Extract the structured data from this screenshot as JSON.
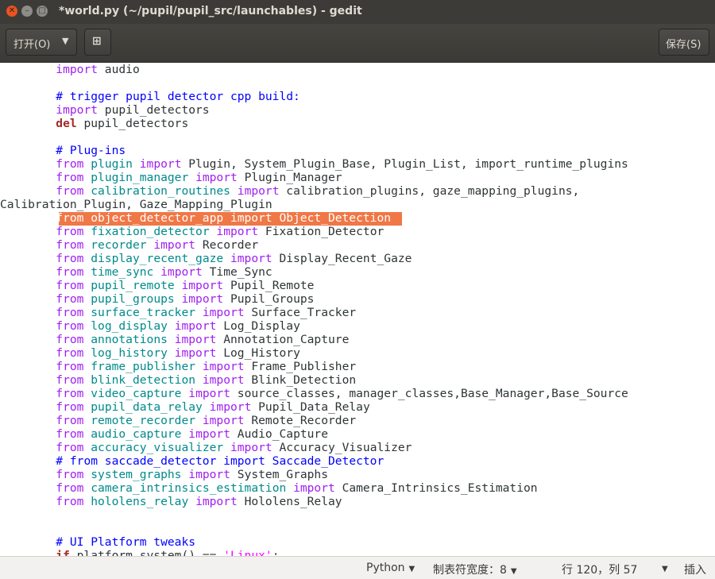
{
  "window": {
    "title": "*world.py (~/pupil/pupil_src/launchables) - gedit"
  },
  "toolbar": {
    "open_label": "打开(O)",
    "save_label": "保存(S)"
  },
  "editor": {
    "lines": [
      {
        "segs": [
          {
            "t": "        "
          },
          {
            "c": "kw",
            "t": "import"
          },
          {
            "t": " audio"
          }
        ]
      },
      {
        "segs": []
      },
      {
        "segs": [
          {
            "t": "        "
          },
          {
            "c": "cm",
            "t": "# trigger pupil detector cpp build:"
          }
        ]
      },
      {
        "segs": [
          {
            "t": "        "
          },
          {
            "c": "kw",
            "t": "import"
          },
          {
            "t": " pupil_detectors"
          }
        ]
      },
      {
        "segs": [
          {
            "t": "        "
          },
          {
            "c": "del",
            "t": "del"
          },
          {
            "t": " pupil_detectors"
          }
        ]
      },
      {
        "segs": []
      },
      {
        "segs": [
          {
            "t": "        "
          },
          {
            "c": "cm",
            "t": "# Plug-ins"
          }
        ]
      },
      {
        "segs": [
          {
            "t": "        "
          },
          {
            "c": "kw",
            "t": "from"
          },
          {
            "t": " "
          },
          {
            "c": "mod",
            "t": "plugin"
          },
          {
            "t": " "
          },
          {
            "c": "kw",
            "t": "import"
          },
          {
            "t": " Plugin, System_Plugin_Base, Plugin_List, import_runtime_plugins"
          }
        ]
      },
      {
        "segs": [
          {
            "t": "        "
          },
          {
            "c": "kw",
            "t": "from"
          },
          {
            "t": " "
          },
          {
            "c": "mod",
            "t": "plugin_manager"
          },
          {
            "t": " "
          },
          {
            "c": "kw",
            "t": "import"
          },
          {
            "t": " Plugin_Manager"
          }
        ]
      },
      {
        "segs": [
          {
            "t": "        "
          },
          {
            "c": "kw",
            "t": "from"
          },
          {
            "t": " "
          },
          {
            "c": "mod",
            "t": "calibration_routines"
          },
          {
            "t": " "
          },
          {
            "c": "kw",
            "t": "import"
          },
          {
            "t": " calibration_plugins, gaze_mapping_plugins,"
          }
        ]
      },
      {
        "segs": [
          {
            "t": "Calibration_Plugin, Gaze_Mapping_Plugin"
          }
        ]
      },
      {
        "hl": true,
        "segs": [
          {
            "t": "        from object_detector_app import Object_Detection"
          }
        ]
      },
      {
        "segs": [
          {
            "t": "        "
          },
          {
            "c": "kw",
            "t": "from"
          },
          {
            "t": " "
          },
          {
            "c": "mod",
            "t": "fixation_detector"
          },
          {
            "t": " "
          },
          {
            "c": "kw",
            "t": "import"
          },
          {
            "t": " Fixation_Detector"
          }
        ]
      },
      {
        "segs": [
          {
            "t": "        "
          },
          {
            "c": "kw",
            "t": "from"
          },
          {
            "t": " "
          },
          {
            "c": "mod",
            "t": "recorder"
          },
          {
            "t": " "
          },
          {
            "c": "kw",
            "t": "import"
          },
          {
            "t": " Recorder"
          }
        ]
      },
      {
        "segs": [
          {
            "t": "        "
          },
          {
            "c": "kw",
            "t": "from"
          },
          {
            "t": " "
          },
          {
            "c": "mod",
            "t": "display_recent_gaze"
          },
          {
            "t": " "
          },
          {
            "c": "kw",
            "t": "import"
          },
          {
            "t": " Display_Recent_Gaze"
          }
        ]
      },
      {
        "segs": [
          {
            "t": "        "
          },
          {
            "c": "kw",
            "t": "from"
          },
          {
            "t": " "
          },
          {
            "c": "mod",
            "t": "time_sync"
          },
          {
            "t": " "
          },
          {
            "c": "kw",
            "t": "import"
          },
          {
            "t": " Time_Sync"
          }
        ]
      },
      {
        "segs": [
          {
            "t": "        "
          },
          {
            "c": "kw",
            "t": "from"
          },
          {
            "t": " "
          },
          {
            "c": "mod",
            "t": "pupil_remote"
          },
          {
            "t": " "
          },
          {
            "c": "kw",
            "t": "import"
          },
          {
            "t": " Pupil_Remote"
          }
        ]
      },
      {
        "segs": [
          {
            "t": "        "
          },
          {
            "c": "kw",
            "t": "from"
          },
          {
            "t": " "
          },
          {
            "c": "mod",
            "t": "pupil_groups"
          },
          {
            "t": " "
          },
          {
            "c": "kw",
            "t": "import"
          },
          {
            "t": " Pupil_Groups"
          }
        ]
      },
      {
        "segs": [
          {
            "t": "        "
          },
          {
            "c": "kw",
            "t": "from"
          },
          {
            "t": " "
          },
          {
            "c": "mod",
            "t": "surface_tracker"
          },
          {
            "t": " "
          },
          {
            "c": "kw",
            "t": "import"
          },
          {
            "t": " Surface_Tracker"
          }
        ]
      },
      {
        "segs": [
          {
            "t": "        "
          },
          {
            "c": "kw",
            "t": "from"
          },
          {
            "t": " "
          },
          {
            "c": "mod",
            "t": "log_display"
          },
          {
            "t": " "
          },
          {
            "c": "kw",
            "t": "import"
          },
          {
            "t": " Log_Display"
          }
        ]
      },
      {
        "segs": [
          {
            "t": "        "
          },
          {
            "c": "kw",
            "t": "from"
          },
          {
            "t": " "
          },
          {
            "c": "mod",
            "t": "annotations"
          },
          {
            "t": " "
          },
          {
            "c": "kw",
            "t": "import"
          },
          {
            "t": " Annotation_Capture"
          }
        ]
      },
      {
        "segs": [
          {
            "t": "        "
          },
          {
            "c": "kw",
            "t": "from"
          },
          {
            "t": " "
          },
          {
            "c": "mod",
            "t": "log_history"
          },
          {
            "t": " "
          },
          {
            "c": "kw",
            "t": "import"
          },
          {
            "t": " Log_History"
          }
        ]
      },
      {
        "segs": [
          {
            "t": "        "
          },
          {
            "c": "kw",
            "t": "from"
          },
          {
            "t": " "
          },
          {
            "c": "mod",
            "t": "frame_publisher"
          },
          {
            "t": " "
          },
          {
            "c": "kw",
            "t": "import"
          },
          {
            "t": " Frame_Publisher"
          }
        ]
      },
      {
        "segs": [
          {
            "t": "        "
          },
          {
            "c": "kw",
            "t": "from"
          },
          {
            "t": " "
          },
          {
            "c": "mod",
            "t": "blink_detection"
          },
          {
            "t": " "
          },
          {
            "c": "kw",
            "t": "import"
          },
          {
            "t": " Blink_Detection"
          }
        ]
      },
      {
        "segs": [
          {
            "t": "        "
          },
          {
            "c": "kw",
            "t": "from"
          },
          {
            "t": " "
          },
          {
            "c": "mod",
            "t": "video_capture"
          },
          {
            "t": " "
          },
          {
            "c": "kw",
            "t": "import"
          },
          {
            "t": " source_classes, manager_classes,Base_Manager,Base_Source"
          }
        ]
      },
      {
        "segs": [
          {
            "t": "        "
          },
          {
            "c": "kw",
            "t": "from"
          },
          {
            "t": " "
          },
          {
            "c": "mod",
            "t": "pupil_data_relay"
          },
          {
            "t": " "
          },
          {
            "c": "kw",
            "t": "import"
          },
          {
            "t": " Pupil_Data_Relay"
          }
        ]
      },
      {
        "segs": [
          {
            "t": "        "
          },
          {
            "c": "kw",
            "t": "from"
          },
          {
            "t": " "
          },
          {
            "c": "mod",
            "t": "remote_recorder"
          },
          {
            "t": " "
          },
          {
            "c": "kw",
            "t": "import"
          },
          {
            "t": " Remote_Recorder"
          }
        ]
      },
      {
        "segs": [
          {
            "t": "        "
          },
          {
            "c": "kw",
            "t": "from"
          },
          {
            "t": " "
          },
          {
            "c": "mod",
            "t": "audio_capture"
          },
          {
            "t": " "
          },
          {
            "c": "kw",
            "t": "import"
          },
          {
            "t": " Audio_Capture"
          }
        ]
      },
      {
        "segs": [
          {
            "t": "        "
          },
          {
            "c": "kw",
            "t": "from"
          },
          {
            "t": " "
          },
          {
            "c": "mod",
            "t": "accuracy_visualizer"
          },
          {
            "t": " "
          },
          {
            "c": "kw",
            "t": "import"
          },
          {
            "t": " Accuracy_Visualizer"
          }
        ]
      },
      {
        "segs": [
          {
            "t": "        "
          },
          {
            "c": "cm",
            "t": "# from saccade_detector import Saccade_Detector"
          }
        ]
      },
      {
        "segs": [
          {
            "t": "        "
          },
          {
            "c": "kw",
            "t": "from"
          },
          {
            "t": " "
          },
          {
            "c": "mod",
            "t": "system_graphs"
          },
          {
            "t": " "
          },
          {
            "c": "kw",
            "t": "import"
          },
          {
            "t": " System_Graphs"
          }
        ]
      },
      {
        "segs": [
          {
            "t": "        "
          },
          {
            "c": "kw",
            "t": "from"
          },
          {
            "t": " "
          },
          {
            "c": "mod",
            "t": "camera_intrinsics_estimation"
          },
          {
            "t": " "
          },
          {
            "c": "kw",
            "t": "import"
          },
          {
            "t": " Camera_Intrinsics_Estimation"
          }
        ]
      },
      {
        "segs": [
          {
            "t": "        "
          },
          {
            "c": "kw",
            "t": "from"
          },
          {
            "t": " "
          },
          {
            "c": "mod",
            "t": "hololens_relay"
          },
          {
            "t": " "
          },
          {
            "c": "kw",
            "t": "import"
          },
          {
            "t": " Hololens_Relay"
          }
        ]
      },
      {
        "segs": []
      },
      {
        "segs": []
      },
      {
        "segs": [
          {
            "t": "        "
          },
          {
            "c": "cm",
            "t": "# UI Platform tweaks"
          }
        ]
      },
      {
        "segs": [
          {
            "t": "        "
          },
          {
            "c": "del",
            "t": "if"
          },
          {
            "t": " platform.system() == "
          },
          {
            "c": "str",
            "t": "'Linux'"
          },
          {
            "t": ":"
          }
        ]
      }
    ]
  },
  "statusbar": {
    "language": "Python",
    "tab_width": "制表符宽度：8",
    "position": "行 120，列 57",
    "mode": "插入"
  }
}
